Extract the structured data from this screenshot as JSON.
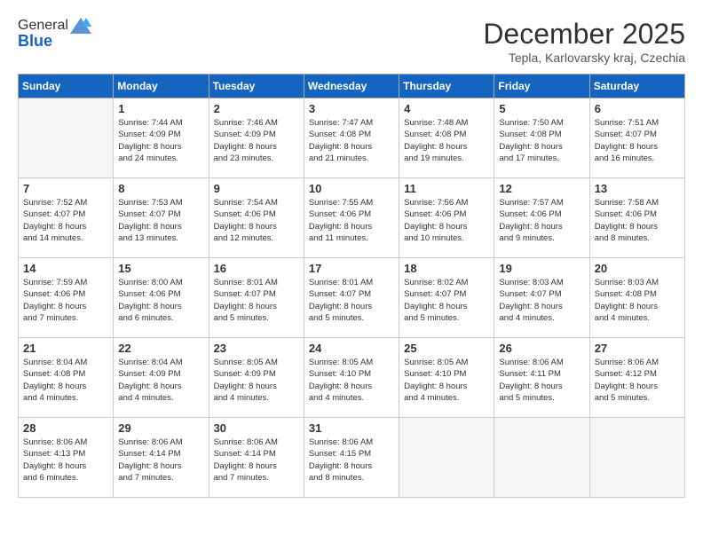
{
  "header": {
    "logo_line1": "General",
    "logo_line2": "Blue",
    "month_title": "December 2025",
    "subtitle": "Tepla, Karlovarsky kraj, Czechia"
  },
  "weekdays": [
    "Sunday",
    "Monday",
    "Tuesday",
    "Wednesday",
    "Thursday",
    "Friday",
    "Saturday"
  ],
  "weeks": [
    [
      {
        "day": "",
        "info": ""
      },
      {
        "day": "1",
        "info": "Sunrise: 7:44 AM\nSunset: 4:09 PM\nDaylight: 8 hours\nand 24 minutes."
      },
      {
        "day": "2",
        "info": "Sunrise: 7:46 AM\nSunset: 4:09 PM\nDaylight: 8 hours\nand 23 minutes."
      },
      {
        "day": "3",
        "info": "Sunrise: 7:47 AM\nSunset: 4:08 PM\nDaylight: 8 hours\nand 21 minutes."
      },
      {
        "day": "4",
        "info": "Sunrise: 7:48 AM\nSunset: 4:08 PM\nDaylight: 8 hours\nand 19 minutes."
      },
      {
        "day": "5",
        "info": "Sunrise: 7:50 AM\nSunset: 4:08 PM\nDaylight: 8 hours\nand 17 minutes."
      },
      {
        "day": "6",
        "info": "Sunrise: 7:51 AM\nSunset: 4:07 PM\nDaylight: 8 hours\nand 16 minutes."
      }
    ],
    [
      {
        "day": "7",
        "info": "Sunrise: 7:52 AM\nSunset: 4:07 PM\nDaylight: 8 hours\nand 14 minutes."
      },
      {
        "day": "8",
        "info": "Sunrise: 7:53 AM\nSunset: 4:07 PM\nDaylight: 8 hours\nand 13 minutes."
      },
      {
        "day": "9",
        "info": "Sunrise: 7:54 AM\nSunset: 4:06 PM\nDaylight: 8 hours\nand 12 minutes."
      },
      {
        "day": "10",
        "info": "Sunrise: 7:55 AM\nSunset: 4:06 PM\nDaylight: 8 hours\nand 11 minutes."
      },
      {
        "day": "11",
        "info": "Sunrise: 7:56 AM\nSunset: 4:06 PM\nDaylight: 8 hours\nand 10 minutes."
      },
      {
        "day": "12",
        "info": "Sunrise: 7:57 AM\nSunset: 4:06 PM\nDaylight: 8 hours\nand 9 minutes."
      },
      {
        "day": "13",
        "info": "Sunrise: 7:58 AM\nSunset: 4:06 PM\nDaylight: 8 hours\nand 8 minutes."
      }
    ],
    [
      {
        "day": "14",
        "info": "Sunrise: 7:59 AM\nSunset: 4:06 PM\nDaylight: 8 hours\nand 7 minutes."
      },
      {
        "day": "15",
        "info": "Sunrise: 8:00 AM\nSunset: 4:06 PM\nDaylight: 8 hours\nand 6 minutes."
      },
      {
        "day": "16",
        "info": "Sunrise: 8:01 AM\nSunset: 4:07 PM\nDaylight: 8 hours\nand 5 minutes."
      },
      {
        "day": "17",
        "info": "Sunrise: 8:01 AM\nSunset: 4:07 PM\nDaylight: 8 hours\nand 5 minutes."
      },
      {
        "day": "18",
        "info": "Sunrise: 8:02 AM\nSunset: 4:07 PM\nDaylight: 8 hours\nand 5 minutes."
      },
      {
        "day": "19",
        "info": "Sunrise: 8:03 AM\nSunset: 4:07 PM\nDaylight: 8 hours\nand 4 minutes."
      },
      {
        "day": "20",
        "info": "Sunrise: 8:03 AM\nSunset: 4:08 PM\nDaylight: 8 hours\nand 4 minutes."
      }
    ],
    [
      {
        "day": "21",
        "info": "Sunrise: 8:04 AM\nSunset: 4:08 PM\nDaylight: 8 hours\nand 4 minutes."
      },
      {
        "day": "22",
        "info": "Sunrise: 8:04 AM\nSunset: 4:09 PM\nDaylight: 8 hours\nand 4 minutes."
      },
      {
        "day": "23",
        "info": "Sunrise: 8:05 AM\nSunset: 4:09 PM\nDaylight: 8 hours\nand 4 minutes."
      },
      {
        "day": "24",
        "info": "Sunrise: 8:05 AM\nSunset: 4:10 PM\nDaylight: 8 hours\nand 4 minutes."
      },
      {
        "day": "25",
        "info": "Sunrise: 8:05 AM\nSunset: 4:10 PM\nDaylight: 8 hours\nand 4 minutes."
      },
      {
        "day": "26",
        "info": "Sunrise: 8:06 AM\nSunset: 4:11 PM\nDaylight: 8 hours\nand 5 minutes."
      },
      {
        "day": "27",
        "info": "Sunrise: 8:06 AM\nSunset: 4:12 PM\nDaylight: 8 hours\nand 5 minutes."
      }
    ],
    [
      {
        "day": "28",
        "info": "Sunrise: 8:06 AM\nSunset: 4:13 PM\nDaylight: 8 hours\nand 6 minutes."
      },
      {
        "day": "29",
        "info": "Sunrise: 8:06 AM\nSunset: 4:14 PM\nDaylight: 8 hours\nand 7 minutes."
      },
      {
        "day": "30",
        "info": "Sunrise: 8:06 AM\nSunset: 4:14 PM\nDaylight: 8 hours\nand 7 minutes."
      },
      {
        "day": "31",
        "info": "Sunrise: 8:06 AM\nSunset: 4:15 PM\nDaylight: 8 hours\nand 8 minutes."
      },
      {
        "day": "",
        "info": ""
      },
      {
        "day": "",
        "info": ""
      },
      {
        "day": "",
        "info": ""
      }
    ]
  ]
}
